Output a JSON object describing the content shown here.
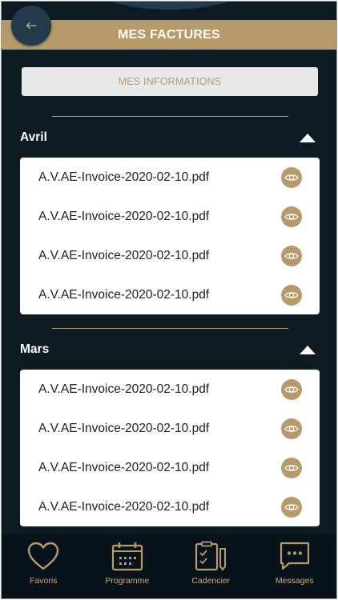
{
  "header": {
    "title": "MES FACTURES"
  },
  "info_button": {
    "label": "MES INFORMATIONS"
  },
  "sections": [
    {
      "title": "Avril",
      "files": [
        "A.V.AE-Invoice-2020-02-10.pdf",
        "A.V.AE-Invoice-2020-02-10.pdf",
        "A.V.AE-Invoice-2020-02-10.pdf",
        "A.V.AE-Invoice-2020-02-10.pdf"
      ]
    },
    {
      "title": "Mars",
      "files": [
        "A.V.AE-Invoice-2020-02-10.pdf",
        "A.V.AE-Invoice-2020-02-10.pdf",
        "A.V.AE-Invoice-2020-02-10.pdf",
        "A.V.AE-Invoice-2020-02-10.pdf"
      ]
    }
  ],
  "nav": [
    {
      "label": "Favoris",
      "icon": "heart-icon"
    },
    {
      "label": "Programme",
      "icon": "calendar-icon"
    },
    {
      "label": "Cadencier",
      "icon": "checklist-icon"
    },
    {
      "label": "Messages",
      "icon": "chat-icon"
    }
  ],
  "colors": {
    "accent": "#b79a6a",
    "background": "#0f1b23",
    "button_bg": "#213a4c",
    "nav_bg": "#08121a"
  }
}
